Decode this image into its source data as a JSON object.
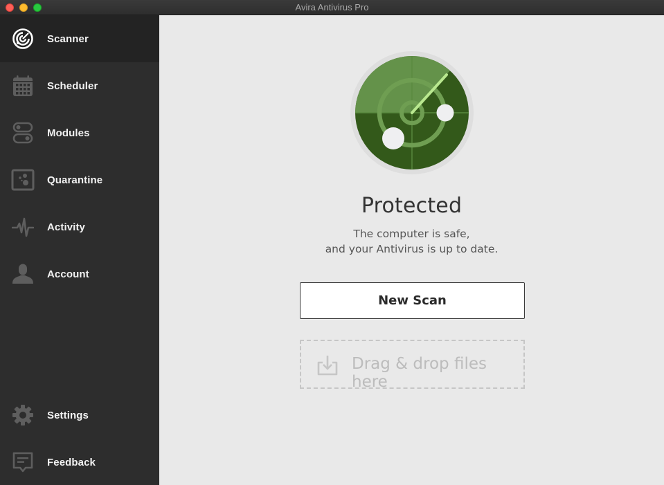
{
  "window": {
    "title": "Avira Antivirus Pro",
    "controls": [
      "close",
      "minimize",
      "maximize"
    ]
  },
  "sidebar": {
    "active": "Scanner",
    "items": [
      {
        "label": "Scanner",
        "icon": "radar-icon"
      },
      {
        "label": "Scheduler",
        "icon": "calendar-icon"
      },
      {
        "label": "Modules",
        "icon": "toggles-icon"
      },
      {
        "label": "Quarantine",
        "icon": "quarantine-icon"
      },
      {
        "label": "Activity",
        "icon": "pulse-icon"
      },
      {
        "label": "Account",
        "icon": "user-icon"
      }
    ],
    "bottom_items": [
      {
        "label": "Settings",
        "icon": "gear-icon"
      },
      {
        "label": "Feedback",
        "icon": "feedback-icon"
      }
    ]
  },
  "main": {
    "status_title": "Protected",
    "status_line1": "The computer is safe,",
    "status_line2": "and your Antivirus is up to date.",
    "new_scan_label": "New Scan",
    "dropzone_label": "Drag & drop files here"
  },
  "colors": {
    "sidebar_bg": "#2d2d2d",
    "sidebar_active_bg": "#232323",
    "main_bg": "#e9e9e9",
    "radar_dark": "#33591a",
    "radar_light": "#64924a",
    "radar_sweep": "#b9e88f"
  }
}
